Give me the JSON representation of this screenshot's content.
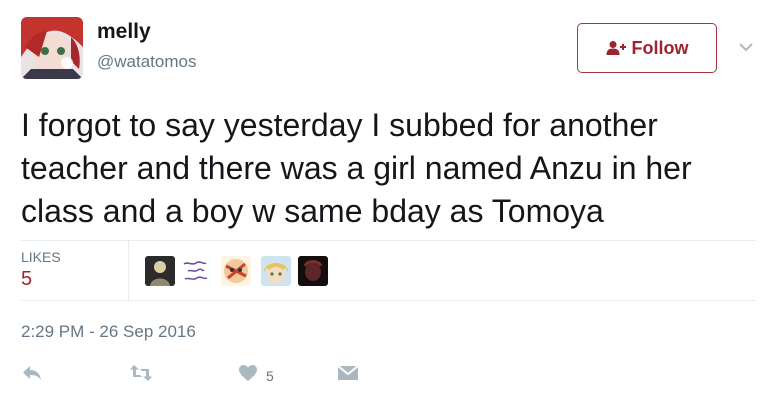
{
  "tweet": {
    "author_name": "melly",
    "author_handle": "@watatomos",
    "follow_label": "Follow",
    "text": "I forgot to say yesterday I subbed for another teacher and there was a girl named Anzu in her class and a boy w same bday as Tomoya",
    "likes_label": "LIKES",
    "likes_count": "5",
    "timestamp": "2:29 PM - 26 Sep 2016",
    "like_action_count": "5"
  },
  "likers": [
    {
      "icon": "avatar-dark-figure"
    },
    {
      "icon": "avatar-handwritten-text"
    },
    {
      "icon": "avatar-face-bandaged"
    },
    {
      "icon": "avatar-blond-anime"
    },
    {
      "icon": "avatar-dark-red"
    }
  ],
  "icons": {
    "follow": "add-user-icon",
    "more": "chevron-down-icon",
    "reply": "reply-icon",
    "retweet": "retweet-icon",
    "like": "heart-icon",
    "message": "direct-message-icon"
  },
  "colors": {
    "accent": "#9b2430",
    "secondary_text": "#657786",
    "divider": "#e6ecf0",
    "action_icon": "#aab8c2"
  }
}
